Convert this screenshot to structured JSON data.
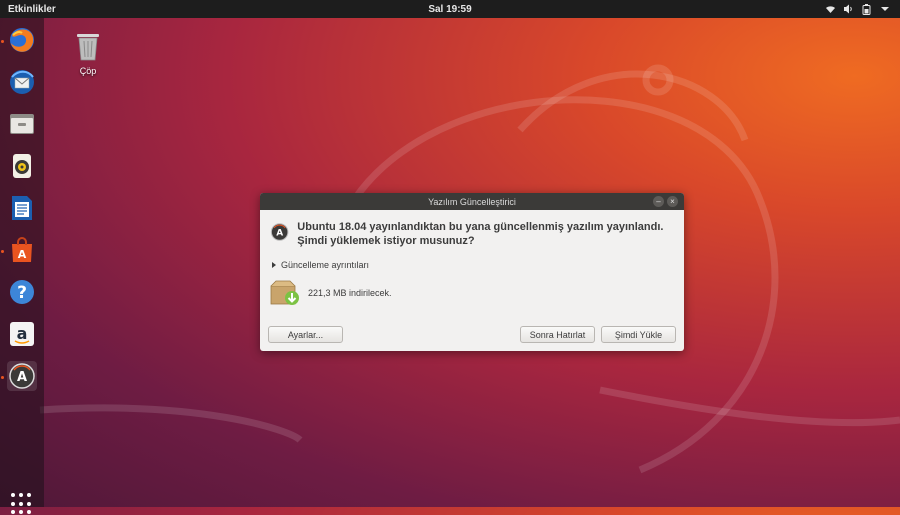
{
  "topbar": {
    "activities": "Etkinlikler",
    "clock": "Sal 19:59",
    "tray_icons": [
      "wifi-icon",
      "volume-icon",
      "battery-icon",
      "dropdown-arrow-icon"
    ]
  },
  "dock": {
    "items": [
      {
        "name": "firefox",
        "icon": "firefox-icon",
        "running": true
      },
      {
        "name": "thunderbird",
        "icon": "thunderbird-icon",
        "running": false
      },
      {
        "name": "files",
        "icon": "files-icon",
        "running": false
      },
      {
        "name": "rhythmbox",
        "icon": "rhythmbox-icon",
        "running": false
      },
      {
        "name": "libreoffice-writer",
        "icon": "writer-icon",
        "running": false
      },
      {
        "name": "ubuntu-software",
        "icon": "software-bag-icon",
        "running": false
      },
      {
        "name": "help",
        "icon": "help-icon",
        "running": false
      },
      {
        "name": "amazon",
        "icon": "amazon-icon",
        "running": false
      },
      {
        "name": "software-updater",
        "icon": "software-updater-icon",
        "running": true
      }
    ],
    "show_apps_icon": "apps-grid-icon"
  },
  "desktop": {
    "trash_label": "Çöp"
  },
  "dialog": {
    "title": "Yazılım Güncelleştirici",
    "message": "Ubuntu 18.04 yayınlandıktan bu yana güncellenmiş yazılım yayınlandı. Şimdi yüklemek istiyor musunuz?",
    "details_label": "Güncelleme ayrıntıları",
    "download_text": "221,3 MB indirilecek.",
    "buttons": {
      "settings": "Ayarlar...",
      "remind_later": "Sonra Hatırlat",
      "install_now": "Şimdi Yükle"
    }
  },
  "colors": {
    "ubuntu_orange": "#e95420",
    "topbar": "#1d1d1d",
    "dialog_bg": "#f2f1f0",
    "titlebar": "#3b3a38"
  }
}
